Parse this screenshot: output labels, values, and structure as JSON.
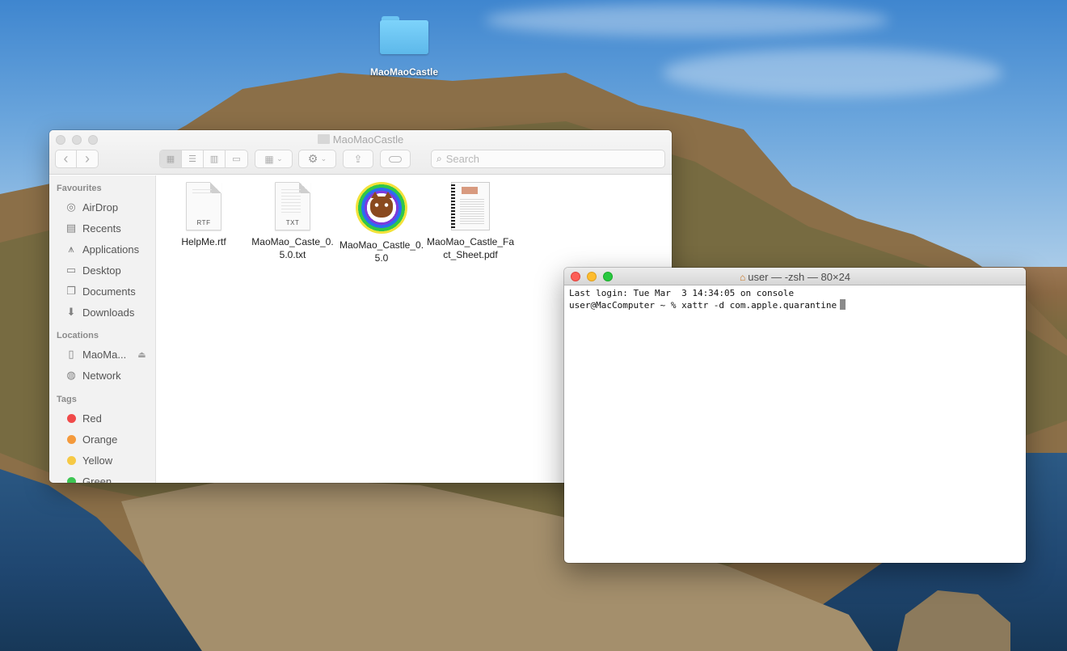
{
  "desktop": {
    "icons": [
      {
        "label": "MaoMaoCastle",
        "icon": "folder-icon"
      }
    ]
  },
  "finder": {
    "title": "MaoMaoCastle",
    "toolbar": {
      "back": "‹",
      "forward": "›",
      "view_modes": [
        "icon-view",
        "list-view",
        "column-view",
        "gallery-view"
      ],
      "group_by_icon": "group-icon",
      "action_icon": "gear-icon",
      "share_icon": "share-icon",
      "tag_icon": "tag-icon",
      "search_placeholder": "Search"
    },
    "sidebar": {
      "favourites_label": "Favourites",
      "favourites": [
        {
          "label": "AirDrop",
          "icon": "airdrop-icon",
          "glyph": "◎"
        },
        {
          "label": "Recents",
          "icon": "recents-icon",
          "glyph": "▤"
        },
        {
          "label": "Applications",
          "icon": "applications-icon",
          "glyph": "⩚"
        },
        {
          "label": "Desktop",
          "icon": "desktop-icon",
          "glyph": "▭"
        },
        {
          "label": "Documents",
          "icon": "documents-icon",
          "glyph": "❐"
        },
        {
          "label": "Downloads",
          "icon": "downloads-icon",
          "glyph": "⬇"
        }
      ],
      "locations_label": "Locations",
      "locations": [
        {
          "label": "MaoMa...",
          "icon": "disk-icon",
          "glyph": "▯",
          "eject": "⏏"
        },
        {
          "label": "Network",
          "icon": "network-icon",
          "glyph": "◍"
        }
      ],
      "tags_label": "Tags",
      "tags": [
        {
          "label": "Red",
          "color": "#f04a4a"
        },
        {
          "label": "Orange",
          "color": "#f49a3c"
        },
        {
          "label": "Yellow",
          "color": "#f6c945"
        },
        {
          "label": "Green",
          "color": "#3ec553"
        }
      ]
    },
    "files": [
      {
        "name": "HelpMe.rtf",
        "kind": "rtf",
        "ext": "RTF"
      },
      {
        "name": "MaoMao_Caste_0.5.0.txt",
        "kind": "txt",
        "ext": "TXT"
      },
      {
        "name": "MaoMao_Castle_0.5.0",
        "kind": "app"
      },
      {
        "name": "MaoMao_Castle_Fact_Sheet.pdf",
        "kind": "pdf"
      }
    ]
  },
  "terminal": {
    "title": "user — -zsh — 80×24",
    "lines": [
      "Last login: Tue Mar  3 14:34:05 on console",
      "user@MacComputer ~ % xattr -d com.apple.quarantine"
    ]
  }
}
